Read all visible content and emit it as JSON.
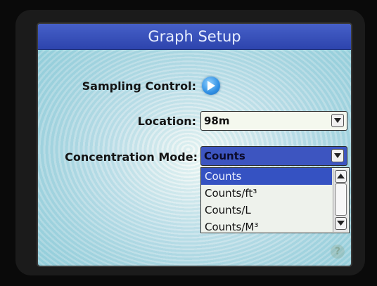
{
  "window": {
    "title": "Graph Setup"
  },
  "sampling_control": {
    "label": "Sampling Control:",
    "button_icon": "play-icon"
  },
  "location": {
    "label": "Location:",
    "value": "98m"
  },
  "concentration_mode": {
    "label": "Concentration Mode:",
    "value": "Counts",
    "options": [
      "Counts",
      "Counts/ft³",
      "Counts/L",
      "Counts/M³"
    ],
    "selected_index": 0
  },
  "help": {
    "icon": "help-icon",
    "glyph": "?"
  },
  "colors": {
    "title_bar": "#3550bb",
    "selection": "#3552c2",
    "play_button": "#2f8fe3"
  }
}
